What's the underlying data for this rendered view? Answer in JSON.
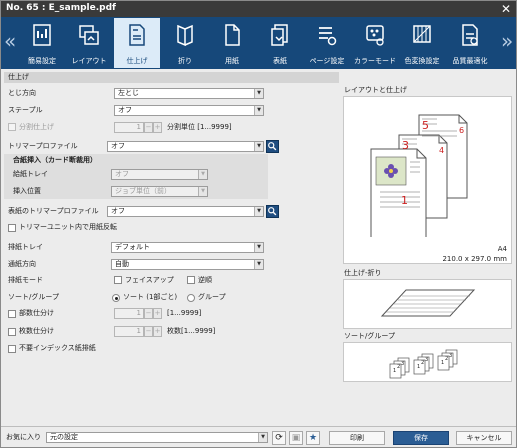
{
  "window": {
    "title": "No. 65 :  E_sample.pdf",
    "close": "✕"
  },
  "nav": {
    "prev": "«",
    "next": "»"
  },
  "tabs": [
    "簡易設定",
    "レイアウト",
    "仕上げ",
    "折り",
    "用紙",
    "表紙",
    "ページ設定",
    "カラーモード",
    "色変換設定",
    "品質最適化"
  ],
  "active_tab": "仕上げ",
  "section": {
    "title": "仕上げ"
  },
  "binding": {
    "label": "とじ方向",
    "value": "左とじ"
  },
  "staple": {
    "label": "ステープル",
    "value": "オフ"
  },
  "split_finish": {
    "label": "分割仕上げ",
    "count": "1",
    "unit": "分割単位 [1...9999]"
  },
  "trimmer": {
    "label": "トリマープロファイル",
    "value": "オフ"
  },
  "slip_sheet": {
    "title": "合紙挿入（カード断裁用）",
    "tray_label": "給紙トレイ",
    "tray_value": "オフ",
    "pos_label": "挿入位置",
    "pos_value": "ジョブ単位（前）"
  },
  "cover_trimmer": {
    "label": "表紙のトリマープロファイル",
    "value": "オフ"
  },
  "trimmer_reverse": {
    "label": "トリマーユニット内で用紙反転"
  },
  "output_tray": {
    "label": "排紙トレイ",
    "value": "デフォルト"
  },
  "paper_path": {
    "label": "通紙方向",
    "value": "自動"
  },
  "output_mode": {
    "label": "排紙モード",
    "faceup": "フェイスアップ",
    "reverse": "逆順"
  },
  "sort_group": {
    "label": "ソート/グループ",
    "sort": "ソート (1部ごと)",
    "group": "グループ"
  },
  "copies_sets": {
    "label": "部数仕分け",
    "count": "1",
    "unit": "[1...9999]"
  },
  "sheets_sets": {
    "label": "枚数仕分け",
    "count": "1",
    "unit": "枚数[1...9999]"
  },
  "skip_index": {
    "label": "不要インデックス紙排紙"
  },
  "preview": {
    "layout_title": "レイアウトと仕上げ",
    "page_labels": [
      "5",
      "6",
      "3",
      "4",
      "1"
    ],
    "paper_size": "A4",
    "paper_dim": "210.0 x 297.0 mm",
    "fold_title": "仕上げ-折り",
    "sort_title": "ソート/グループ",
    "sort_labels": [
      "1",
      "2",
      "3"
    ]
  },
  "bottom": {
    "favorites_label": "お気に入り",
    "favorites_value": "元の設定",
    "print": "印刷",
    "save": "保存",
    "cancel": "キャンセル"
  },
  "colors": {
    "titlebar": "#3a3a3a",
    "tabbar": "#16487a",
    "active_tab": "#dcebf8",
    "accent": "#2b5d94",
    "page_number": "#cc2020"
  }
}
